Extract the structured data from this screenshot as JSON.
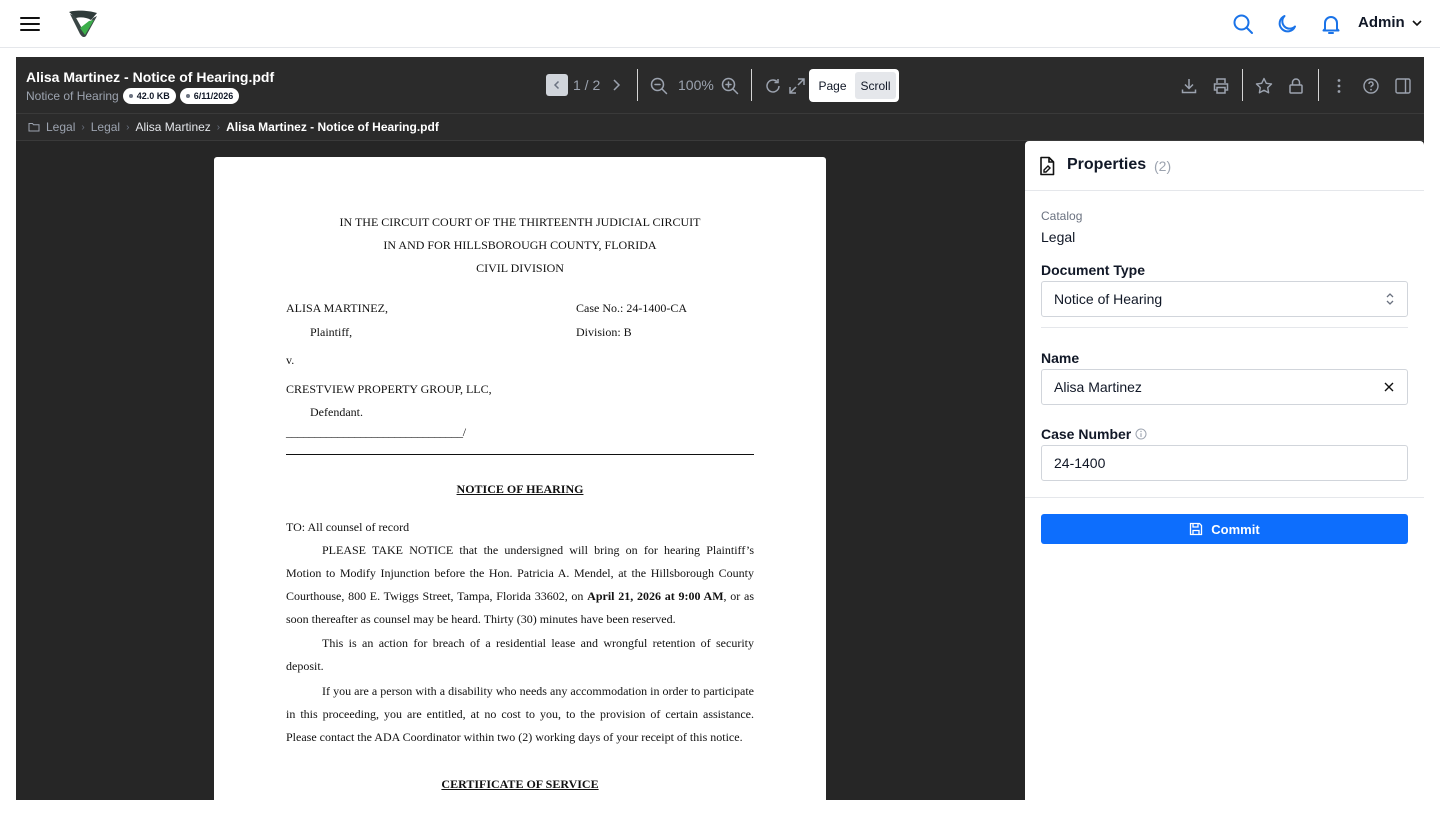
{
  "app": {
    "user_name": "Admin",
    "accent": "#1a73e8"
  },
  "viewer": {
    "title": "Alisa Martinez - Notice of Hearing.pdf",
    "doc_type_label": "Notice of Hearing",
    "file_size": "42.0 KB",
    "date": "6/11/2026",
    "page_indicator": "1 / 2",
    "zoom": "100%",
    "view_modes": [
      "Page",
      "Scroll"
    ],
    "selected_view_mode": "Scroll"
  },
  "breadcrumb": [
    "Legal",
    "Legal",
    "Alisa Martinez",
    "Alisa Martinez - Notice of Hearing.pdf"
  ],
  "document": {
    "court_lines": [
      "IN THE CIRCUIT COURT OF THE THIRTEENTH JUDICIAL CIRCUIT",
      "IN AND FOR HILLSBOROUGH COUNTY, FLORIDA",
      "CIVIL DIVISION"
    ],
    "plaintiff": "ALISA MARTINEZ,",
    "plaintiff_role": "Plaintiff,",
    "versus": "v.",
    "defendant": "CRESTVIEW PROPERTY GROUP, LLC,",
    "defendant_role": "Defendant.",
    "signature_line": "_______________________________/",
    "case_no": "Case No.: 24-1400-CA",
    "division": "Division: B",
    "heading": "NOTICE OF HEARING",
    "to_line": "TO: All counsel of record",
    "para1_a": "PLEASE TAKE NOTICE that the undersigned will bring on for hearing Plaintiff’s Motion to Modify Injunction before the Hon. Patricia A. Mendel, at the Hillsborough County Courthouse, 800 E. Twiggs Street, Tampa, Florida 33602, on ",
    "para1_bold": "April 21, 2026 at 9:00 AM",
    "para1_b": ", or as soon thereafter as counsel may be heard. Thirty (30) minutes have been reserved.",
    "para2": "This is an action for breach of a residential lease and wrongful retention of security deposit.",
    "para3": "If you are a person with a disability who needs any accommodation in order to participate in this proceeding, you are entitled, at no cost to you, to the provision of certain assistance. Please contact the ADA Coordinator within two (2) working days of your receipt of this notice.",
    "certificate_heading": "CERTIFICATE OF SERVICE"
  },
  "properties": {
    "title": "Properties",
    "count": "(2)",
    "catalog_label": "Catalog",
    "catalog_value": "Legal",
    "doc_type_label": "Document Type",
    "doc_type_value": "Notice of Hearing",
    "name_label": "Name",
    "name_value": "Alisa Martinez",
    "case_number_label": "Case Number",
    "case_number_value": "24-1400",
    "commit_label": "Commit"
  }
}
